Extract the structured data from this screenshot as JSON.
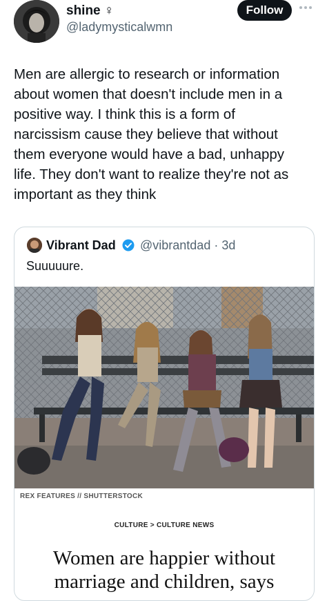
{
  "author": {
    "display_name": "shine ♀",
    "handle": "@ladymysticalwmn",
    "avatar_icon": "profile-photo"
  },
  "actions": {
    "follow_label": "Follow",
    "more_icon": "more-dots-icon"
  },
  "tweet": {
    "lines": [
      "Men are allergic to research or information",
      "about women that doesn't include men in a",
      "positive way. I think this is a form of",
      "narcissism cause they believe that without",
      "them everyone would have a bad, unhappy",
      "life. They don't want to realize they're not as",
      "important as they think"
    ]
  },
  "quote": {
    "display_name": "Vibrant Dad",
    "handle": "@vibrantdad · 3d",
    "verified_color": "#1d9bf0",
    "text": "Suuuuure.",
    "photo_credit": "REX FEATURES // SHUTTERSTOCK",
    "breadcrumb": "CULTURE > CULTURE NEWS",
    "headline_lines": [
      "Women are happier without",
      "marriage and children, says"
    ]
  }
}
